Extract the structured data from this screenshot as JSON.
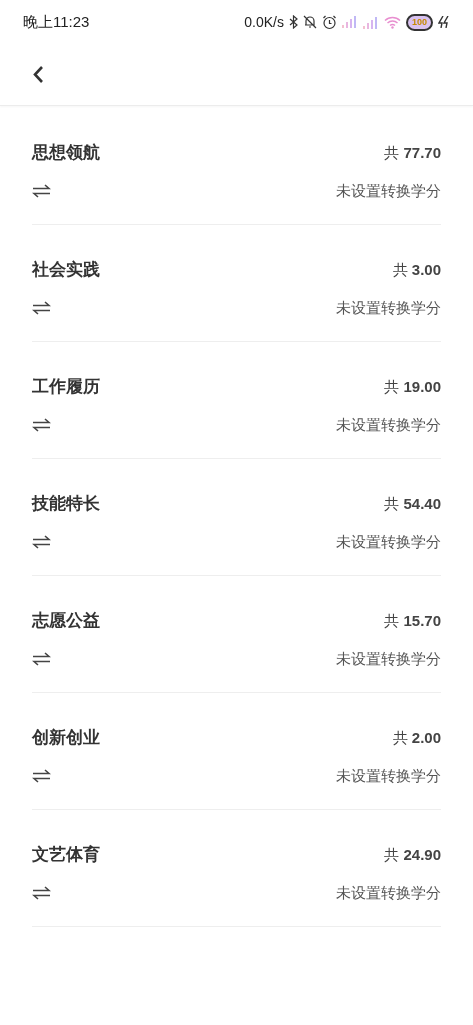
{
  "status_bar": {
    "time": "晚上11:23",
    "net_speed": "0.0K/s",
    "battery": "100"
  },
  "items": [
    {
      "title": "思想领航",
      "total": "共 **77.70**",
      "conversion": "未设置转换学分"
    },
    {
      "title": "社会实践",
      "total": "共 **3.00**",
      "conversion": "未设置转换学分"
    },
    {
      "title": "工作履历",
      "total": "共 **19.00**",
      "conversion": "未设置转换学分"
    },
    {
      "title": "技能特长",
      "total": "共 **54.40**",
      "conversion": "未设置转换学分"
    },
    {
      "title": "志愿公益",
      "total": "共 **15.70**",
      "conversion": "未设置转换学分"
    },
    {
      "title": "创新创业",
      "total": "共 **2.00**",
      "conversion": "未设置转换学分"
    },
    {
      "title": "文艺体育",
      "total": "共 **24.90**",
      "conversion": "未设置转换学分"
    }
  ]
}
